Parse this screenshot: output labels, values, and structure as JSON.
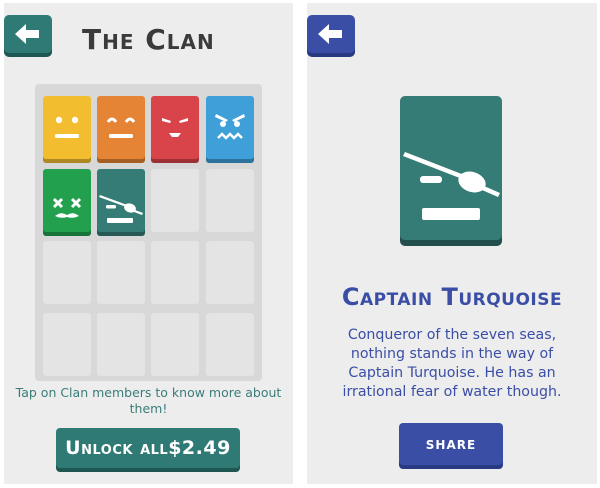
{
  "left_screen": {
    "back_button": {
      "icon": "arrow-left-icon",
      "color": "#307a75"
    },
    "title": "The Clan",
    "grid": {
      "rows": 4,
      "columns": 4,
      "members": [
        {
          "name": "yellow-member",
          "color": "#f2bd2f",
          "face": "neutral"
        },
        {
          "name": "orange-member",
          "color": "#e58434",
          "face": "happy"
        },
        {
          "name": "red-member",
          "color": "#d9444a",
          "face": "smug"
        },
        {
          "name": "blue-member",
          "color": "#3f9fd9",
          "face": "angry"
        },
        {
          "name": "green-member",
          "color": "#22a04e",
          "face": "mustache-x-eyes"
        },
        {
          "name": "teal-member",
          "color": "#357b76",
          "face": "eyepatch"
        }
      ]
    },
    "hint_text": "Tap on Clan members to know more about them!",
    "unlock_button": "Unlock all$2.49"
  },
  "right_screen": {
    "back_button": {
      "icon": "arrow-left-icon",
      "color": "#3a4ea6"
    },
    "character": {
      "name": "Captain Turquoise",
      "color": "#357b76",
      "description": "Conqueror of the seven seas, nothing stands in the way of Captain Turquoise. He has an irrational fear of water though."
    },
    "share_button": "share"
  }
}
